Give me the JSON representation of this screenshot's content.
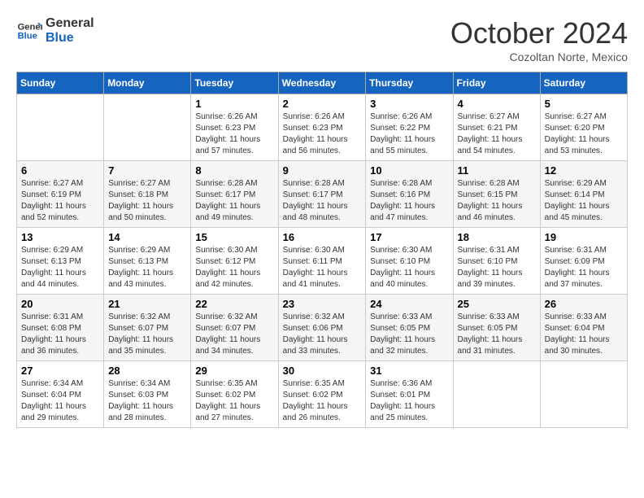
{
  "header": {
    "logo_line1": "General",
    "logo_line2": "Blue",
    "month": "October 2024",
    "location": "Cozoltan Norte, Mexico"
  },
  "days_of_week": [
    "Sunday",
    "Monday",
    "Tuesday",
    "Wednesday",
    "Thursday",
    "Friday",
    "Saturday"
  ],
  "weeks": [
    [
      {
        "day": "",
        "info": ""
      },
      {
        "day": "",
        "info": ""
      },
      {
        "day": "1",
        "info": "Sunrise: 6:26 AM\nSunset: 6:23 PM\nDaylight: 11 hours and 57 minutes."
      },
      {
        "day": "2",
        "info": "Sunrise: 6:26 AM\nSunset: 6:23 PM\nDaylight: 11 hours and 56 minutes."
      },
      {
        "day": "3",
        "info": "Sunrise: 6:26 AM\nSunset: 6:22 PM\nDaylight: 11 hours and 55 minutes."
      },
      {
        "day": "4",
        "info": "Sunrise: 6:27 AM\nSunset: 6:21 PM\nDaylight: 11 hours and 54 minutes."
      },
      {
        "day": "5",
        "info": "Sunrise: 6:27 AM\nSunset: 6:20 PM\nDaylight: 11 hours and 53 minutes."
      }
    ],
    [
      {
        "day": "6",
        "info": "Sunrise: 6:27 AM\nSunset: 6:19 PM\nDaylight: 11 hours and 52 minutes."
      },
      {
        "day": "7",
        "info": "Sunrise: 6:27 AM\nSunset: 6:18 PM\nDaylight: 11 hours and 50 minutes."
      },
      {
        "day": "8",
        "info": "Sunrise: 6:28 AM\nSunset: 6:17 PM\nDaylight: 11 hours and 49 minutes."
      },
      {
        "day": "9",
        "info": "Sunrise: 6:28 AM\nSunset: 6:17 PM\nDaylight: 11 hours and 48 minutes."
      },
      {
        "day": "10",
        "info": "Sunrise: 6:28 AM\nSunset: 6:16 PM\nDaylight: 11 hours and 47 minutes."
      },
      {
        "day": "11",
        "info": "Sunrise: 6:28 AM\nSunset: 6:15 PM\nDaylight: 11 hours and 46 minutes."
      },
      {
        "day": "12",
        "info": "Sunrise: 6:29 AM\nSunset: 6:14 PM\nDaylight: 11 hours and 45 minutes."
      }
    ],
    [
      {
        "day": "13",
        "info": "Sunrise: 6:29 AM\nSunset: 6:13 PM\nDaylight: 11 hours and 44 minutes."
      },
      {
        "day": "14",
        "info": "Sunrise: 6:29 AM\nSunset: 6:13 PM\nDaylight: 11 hours and 43 minutes."
      },
      {
        "day": "15",
        "info": "Sunrise: 6:30 AM\nSunset: 6:12 PM\nDaylight: 11 hours and 42 minutes."
      },
      {
        "day": "16",
        "info": "Sunrise: 6:30 AM\nSunset: 6:11 PM\nDaylight: 11 hours and 41 minutes."
      },
      {
        "day": "17",
        "info": "Sunrise: 6:30 AM\nSunset: 6:10 PM\nDaylight: 11 hours and 40 minutes."
      },
      {
        "day": "18",
        "info": "Sunrise: 6:31 AM\nSunset: 6:10 PM\nDaylight: 11 hours and 39 minutes."
      },
      {
        "day": "19",
        "info": "Sunrise: 6:31 AM\nSunset: 6:09 PM\nDaylight: 11 hours and 37 minutes."
      }
    ],
    [
      {
        "day": "20",
        "info": "Sunrise: 6:31 AM\nSunset: 6:08 PM\nDaylight: 11 hours and 36 minutes."
      },
      {
        "day": "21",
        "info": "Sunrise: 6:32 AM\nSunset: 6:07 PM\nDaylight: 11 hours and 35 minutes."
      },
      {
        "day": "22",
        "info": "Sunrise: 6:32 AM\nSunset: 6:07 PM\nDaylight: 11 hours and 34 minutes."
      },
      {
        "day": "23",
        "info": "Sunrise: 6:32 AM\nSunset: 6:06 PM\nDaylight: 11 hours and 33 minutes."
      },
      {
        "day": "24",
        "info": "Sunrise: 6:33 AM\nSunset: 6:05 PM\nDaylight: 11 hours and 32 minutes."
      },
      {
        "day": "25",
        "info": "Sunrise: 6:33 AM\nSunset: 6:05 PM\nDaylight: 11 hours and 31 minutes."
      },
      {
        "day": "26",
        "info": "Sunrise: 6:33 AM\nSunset: 6:04 PM\nDaylight: 11 hours and 30 minutes."
      }
    ],
    [
      {
        "day": "27",
        "info": "Sunrise: 6:34 AM\nSunset: 6:04 PM\nDaylight: 11 hours and 29 minutes."
      },
      {
        "day": "28",
        "info": "Sunrise: 6:34 AM\nSunset: 6:03 PM\nDaylight: 11 hours and 28 minutes."
      },
      {
        "day": "29",
        "info": "Sunrise: 6:35 AM\nSunset: 6:02 PM\nDaylight: 11 hours and 27 minutes."
      },
      {
        "day": "30",
        "info": "Sunrise: 6:35 AM\nSunset: 6:02 PM\nDaylight: 11 hours and 26 minutes."
      },
      {
        "day": "31",
        "info": "Sunrise: 6:36 AM\nSunset: 6:01 PM\nDaylight: 11 hours and 25 minutes."
      },
      {
        "day": "",
        "info": ""
      },
      {
        "day": "",
        "info": ""
      }
    ]
  ]
}
